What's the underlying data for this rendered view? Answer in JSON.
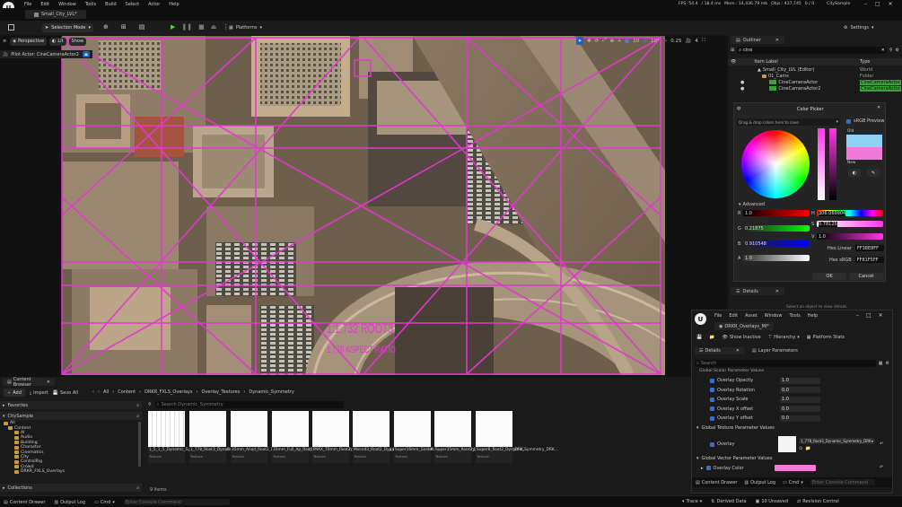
{
  "menu": {
    "file": "File",
    "edit": "Edit",
    "window": "Window",
    "tools": "Tools",
    "build": "Build",
    "select": "Select",
    "actor": "Actor",
    "help": "Help"
  },
  "stats": {
    "fps": "FPS: 54.4",
    "ms": "/ 18.4 ms",
    "mem": "Mem.: 14,436.79 mb",
    "objs": "Objs.: 437,745",
    "fraction": "0 / 0",
    "project": "CitySample"
  },
  "tab": {
    "level": "Small_City_LVL*"
  },
  "toolbar": {
    "selection_mode": "Selection Mode",
    "platforms": "Platforms",
    "settings": "Settings"
  },
  "viewport": {
    "perspective": "Perspective",
    "lit": "Lit",
    "show": "Show",
    "pilot": "Pilot Actor: CineCameraActor2",
    "grid_num1": "10",
    "grid_num2": "10°",
    "speed": "0.25",
    "cam": "4",
    "overlay_title": "1:1.732 ROOT3",
    "overlay_sub": "1.778 ASPECT RATIO"
  },
  "outliner": {
    "title": "Outliner",
    "search": "cine",
    "col_label": "Item Label",
    "col_type": "Type",
    "rows": [
      {
        "label": "Small_City_LVL (Editor)",
        "type": "World"
      },
      {
        "label": "01_Cams",
        "type": "Folder"
      },
      {
        "label": "CineCameraActor",
        "type": "CineCameraActor"
      },
      {
        "label": "CineCameraActor2",
        "type": "CineCameraActor"
      }
    ]
  },
  "colorpicker": {
    "title": "Color Picker",
    "srgb": "sRGB Preview",
    "hint": "Drag & drop colors here to save",
    "old": "Old",
    "new": "New",
    "advanced": "Advanced",
    "r_label": "R",
    "g_label": "G",
    "b_label": "B",
    "a_label": "A",
    "r": "1.0",
    "g": "0.21875",
    "b": "0.910548",
    "a": "1.0",
    "h_label": "H",
    "s_label": "S",
    "v_label": "V",
    "h": "306.069904",
    "s": "0.78125",
    "v": "1.0",
    "hex_linear_label": "Hex Linear",
    "hex_linear": "FF38E8FF",
    "hex_srgb_label": "Hex sRGB",
    "hex_srgb": "FF81F5FF",
    "ok": "OK",
    "cancel": "Cancel",
    "old_color": "#8fd0f5",
    "new_color": "#f07ad8"
  },
  "details": {
    "title": "Details",
    "hint": "Select an object to view details."
  },
  "material": {
    "menu_file": "File",
    "menu_edit": "Edit",
    "menu_asset": "Asset",
    "menu_window": "Window",
    "menu_tools": "Tools",
    "menu_help": "Help",
    "tab": "DRKR_Overlays_MI*",
    "show_inactive": "Show Inactive",
    "hierarchy": "Hierarchy",
    "platform_stats": "Platform Stats",
    "details": "Details",
    "layer_params": "Layer Parameters",
    "search": "Search",
    "section_scalar": "Global Scalar Parameter Values",
    "params": [
      {
        "name": "Overlay Opacity",
        "value": "1.0"
      },
      {
        "name": "Overlay Rotation",
        "value": "0.0"
      },
      {
        "name": "Overlay Scale",
        "value": "1.0"
      },
      {
        "name": "Overlay X offset",
        "value": "0.0"
      },
      {
        "name": "Overlay Y offset",
        "value": "0.0"
      }
    ],
    "section_texture": "Global Texture Parameter Values",
    "overlay": "Overlay",
    "overlay_tex": "1_778_Root3_Dynamic_Symmetry_DRK",
    "section_vector": "Global Vector Parameter Values",
    "overlay_color": "Overlay Color",
    "content_drawer": "Content Drawer",
    "output_log": "Output Log",
    "cmd": "Cmd",
    "console": "Enter Console Command"
  },
  "content_browser": {
    "title": "Content Browser",
    "add": "Add",
    "import": "Import",
    "save_all": "Save All",
    "crumbs": [
      "All",
      "Content",
      "DRKR_FXLS_Overlays",
      "Overlay_Textures",
      "Dynamic_Symmetry"
    ],
    "favorites": "Favorites",
    "project": "CitySample",
    "search_placeholder": "Search Dynamic_Symmetry",
    "tree": [
      "All",
      "Content",
      "AI",
      "Audio",
      "Building",
      "Character",
      "Cinematics",
      "City",
      "ControlRig",
      "Crowd",
      "DRKR_FXLS_Overlays"
    ],
    "assets": [
      {
        "name": "1_5_1_5_Dynamic_Symmetry_DRKR_FXLS",
        "type": "Texture"
      },
      {
        "name": "1_778_Root3_Dynamic_Symmetry_DRK...",
        "type": "Texture"
      },
      {
        "name": "35mm_Anad_Root2_Dynamic_Symmetry_DRK...",
        "type": "Texture"
      },
      {
        "name": "35mm_Full_Ap_Root2_Dynamic_Symmetry_DRK...",
        "type": "Texture"
      },
      {
        "name": "IMAX_70mm_Root2_Dynamic_Symmetry_DRK...",
        "type": "Texture"
      },
      {
        "name": "Micro43_Root2_Dynamic_Symmetry_DRK...",
        "type": "Texture"
      },
      {
        "name": "Super16mm_Golden_Dynamic_Symmetry_DRK...",
        "type": "Texture"
      },
      {
        "name": "Super35mm_Root2_Dynamic_Symmetry_DRK...",
        "type": "Texture"
      },
      {
        "name": "Super8_Root2_Dynamic_Symmetry_DRK...",
        "type": "Texture"
      }
    ],
    "count": "9 items",
    "collections": "Collections"
  },
  "statusbar": {
    "content_drawer": "Content Drawer",
    "output_log": "Output Log",
    "cmd": "Cmd",
    "console": "Enter Console Command",
    "trace": "Trace",
    "derived": "Derived Data",
    "unsaved": "10 Unsaved",
    "revision": "Revision Control"
  }
}
